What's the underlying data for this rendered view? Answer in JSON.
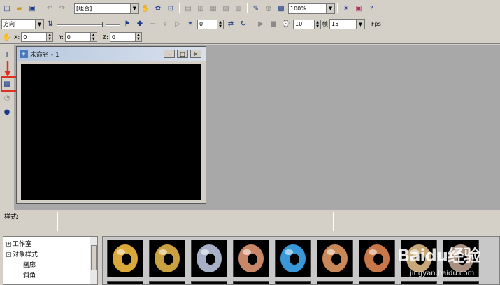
{
  "toolbar1": {
    "group_combo": "[组合]",
    "zoom_combo": "100%"
  },
  "toolbar2": {
    "direction_combo": "方向",
    "frame_value": "0",
    "speed_value": "10",
    "fps_value": "15",
    "fps_label": "Fps",
    "speed_icon_text": "帧"
  },
  "toolbar3": {
    "x_label": "X:",
    "x_value": "0",
    "y_label": "Y:",
    "y_value": "0",
    "z_label": "Z:",
    "z_value": "0"
  },
  "doc_window": {
    "title": "未命名 - 1"
  },
  "status": {
    "style_label": "样式:"
  },
  "tree": {
    "items": [
      {
        "expander": "+",
        "label": "工作室"
      },
      {
        "expander": "-",
        "label": "对象样式"
      },
      {
        "expander": "",
        "label": "画廊"
      },
      {
        "expander": "",
        "label": "斜角"
      }
    ]
  },
  "gallery": {
    "styles": [
      {
        "color": "#d8a838"
      },
      {
        "color": "#caa040"
      },
      {
        "color": "#a8b0c8"
      },
      {
        "color": "#c88868"
      },
      {
        "color": "#3898d8"
      },
      {
        "color": "#c88858"
      },
      {
        "color": "#c87848"
      },
      {
        "color": "#c8a878"
      },
      {
        "color": "#a89080"
      }
    ]
  },
  "watermark": {
    "brand": "Baidu经验",
    "url": "jingyan.baidu.com"
  },
  "colors": {
    "highlight": "#e03020",
    "workspace": "#a8a8a8",
    "canvas": "#000000"
  }
}
